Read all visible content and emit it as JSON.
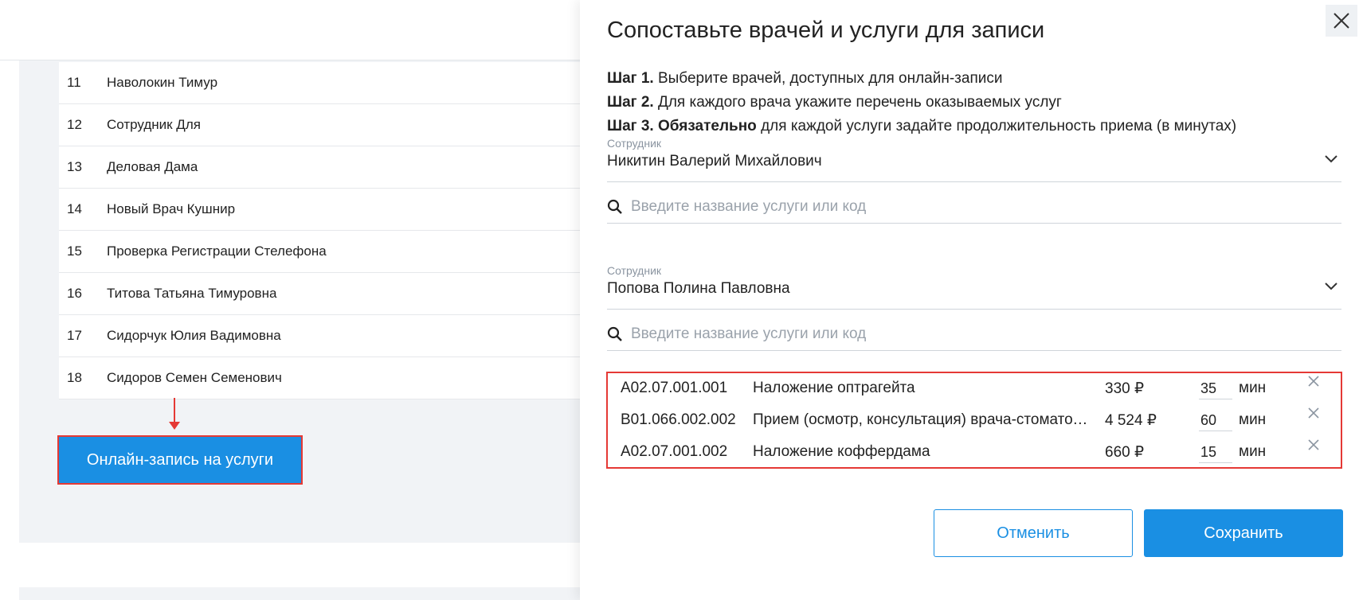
{
  "background": {
    "employees": [
      {
        "num": "11",
        "name": "Наволокин Тимур"
      },
      {
        "num": "12",
        "name": "Сотрудник Для"
      },
      {
        "num": "13",
        "name": "Деловая Дама"
      },
      {
        "num": "14",
        "name": "Новый Врач Кушнир"
      },
      {
        "num": "15",
        "name": "Проверка Регистрации Стелефона"
      },
      {
        "num": "16",
        "name": "Титова Татьяна Тимуровна"
      },
      {
        "num": "17",
        "name": "Сидорчук Юлия Вадимовна"
      },
      {
        "num": "18",
        "name": "Сидоров Семен Семенович"
      }
    ],
    "online_button_label": "Онлайн-запись на услуги"
  },
  "modal": {
    "title": "Сопоставьте врачей и услуги для записи",
    "steps": {
      "s1_bold": "Шаг 1.",
      "s1_text": " Выберите врачей, доступных для онлайн-записи",
      "s2_bold": "Шаг 2.",
      "s2_text": " Для каждого врача укажите перечень оказываемых услуг",
      "s3_bold": "Шаг 3. Обязательно",
      "s3_text": " для каждой услуги задайте продолжительность приема (в минутах)"
    },
    "employee_label": "Сотрудник",
    "search_placeholder": "Введите название услуги или код",
    "blocks": [
      {
        "employee": "Никитин Валерий Михайлович"
      },
      {
        "employee": "Попова Полина Павловна"
      }
    ],
    "services": [
      {
        "code": "A02.07.001.001",
        "name": "Наложение оптрагейта",
        "price": "330 ₽",
        "duration": "35",
        "unit": "мин"
      },
      {
        "code": "B01.066.002.002",
        "name": "Прием (осмотр, консультация) врача-стоматолога",
        "price": "4 524 ₽",
        "duration": "60",
        "unit": "мин"
      },
      {
        "code": "A02.07.001.002",
        "name": "Наложение коффердама",
        "price": "660 ₽",
        "duration": "15",
        "unit": "мин"
      }
    ],
    "cancel_label": "Отменить",
    "save_label": "Сохранить"
  },
  "colors": {
    "accent": "#1a8fe3",
    "highlight": "#e53935",
    "panel_bg": "#f1f3f6"
  },
  "icons": [
    "close-icon",
    "chevron-down-icon",
    "search-icon",
    "remove-icon",
    "arrow-down-icon"
  ]
}
